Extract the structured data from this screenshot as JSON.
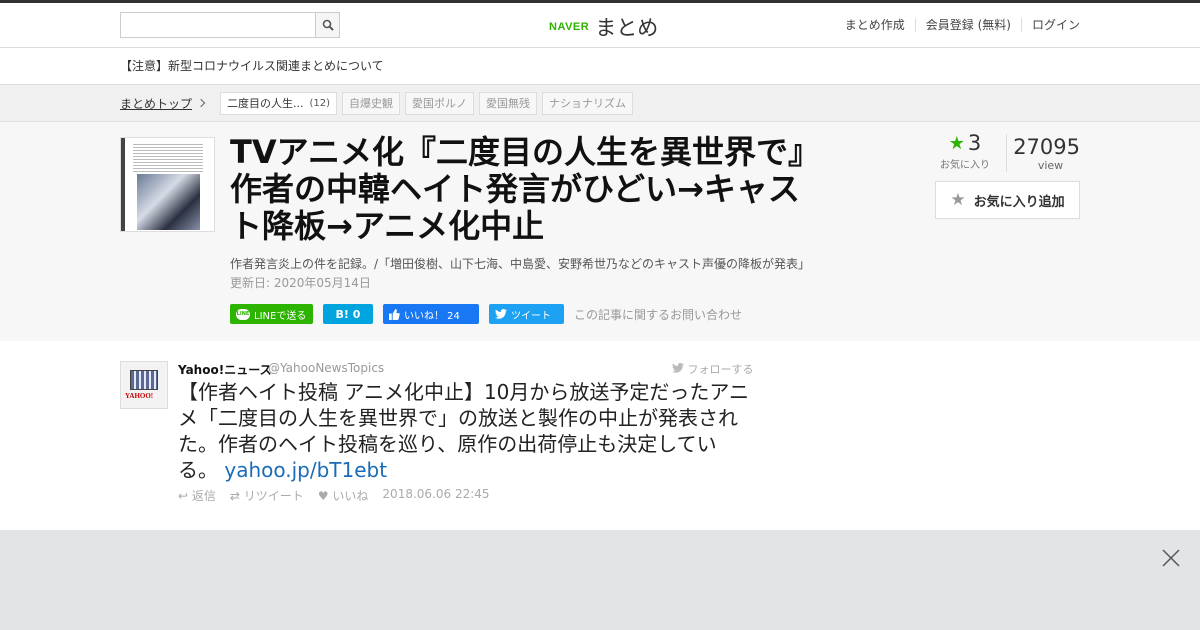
{
  "header": {
    "search_placeholder": "",
    "logo_brand": "NAVER",
    "logo_name": "まとめ",
    "nav": [
      "まとめ作成",
      "会員登録 (無料)",
      "ログイン"
    ]
  },
  "notice": "【注意】新型コロナウイルス関連まとめについて",
  "breadcrumb": {
    "home": "まとめトップ",
    "tags": [
      {
        "label": "二度目の人生...",
        "count": "(12)"
      },
      {
        "label": "自爆史観",
        "count": ""
      },
      {
        "label": "愛国ポルノ",
        "count": ""
      },
      {
        "label": "愛国無残",
        "count": ""
      },
      {
        "label": "ナショナリズム",
        "count": ""
      }
    ]
  },
  "article": {
    "title": "TVアニメ化『二度目の人生を異世界で』作者の中韓ヘイト発言がひどい→キャスト降板→アニメ化中止",
    "description": "作者発言炎上の件を記録。/「増田俊樹、山下七海、中島愛、安野希世乃などのキャスト声優の降板が発表」",
    "updated": "更新日: 2020年05月14日",
    "favorites": "3",
    "favorites_label": "お気に入り",
    "views": "27095",
    "views_label": "view",
    "add_favorite": "お気に入り追加",
    "share": {
      "line": "LINEで送る",
      "line_icon": "LINE",
      "hatena": "B! 0",
      "facebook": "いいね！ 24",
      "twitter": "ツイート",
      "inquiry": "この記事に関するお問い合わせ"
    }
  },
  "tweet": {
    "name": "Yahoo!ニュース",
    "handle": "@YahooNewsTopics",
    "follow": "フォローする",
    "avatar_text": "YAHOO!",
    "text": "【作者ヘイト投稿 アニメ化中止】10月から放送予定だったアニメ「二度目の人生を異世界で」の放送と製作の中止が発表された。作者のヘイト投稿を巡り、原作の出荷停止も決定している。",
    "link": "yahoo.jp/bT1ebt",
    "reply": "返信",
    "retweet": "リツイート",
    "like": "いいね",
    "date": "2018.06.06 22:45"
  },
  "colors": {
    "naver_green": "#2db400",
    "line": "#2db400",
    "hatena": "#00a4de",
    "facebook": "#1877f2",
    "twitter": "#1da1f2",
    "link": "#1a6bb8"
  }
}
